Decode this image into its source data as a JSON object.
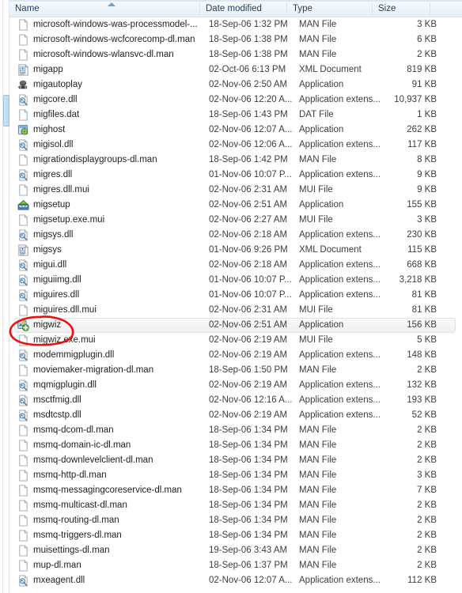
{
  "window": {
    "kind": "file-explorer-details-list"
  },
  "columns": [
    {
      "key": "name",
      "label": "Name",
      "sorted": "ascending"
    },
    {
      "key": "date",
      "label": "Date modified"
    },
    {
      "key": "type",
      "label": "Type"
    },
    {
      "key": "size",
      "label": "Size"
    }
  ],
  "annotation": {
    "shape": "ellipse",
    "color": "#e8120e",
    "target": "migwiz"
  },
  "rows": [
    {
      "icon": "generic-file-icon",
      "name": "microsoft-windows-was-processmodel-...",
      "date": "18-Sep-06 1:32 PM",
      "type": "MAN File",
      "size": "3 KB"
    },
    {
      "icon": "generic-file-icon",
      "name": "microsoft-windows-wcfcorecomp-dl.man",
      "date": "18-Sep-06 1:38 PM",
      "type": "MAN File",
      "size": "6 KB"
    },
    {
      "icon": "generic-file-icon",
      "name": "microsoft-windows-wlansvc-dl.man",
      "date": "18-Sep-06 1:38 PM",
      "type": "MAN File",
      "size": "2 KB"
    },
    {
      "icon": "xml-document-icon",
      "name": "migapp",
      "date": "02-Oct-06 6:13 PM",
      "type": "XML Document",
      "size": "819 KB"
    },
    {
      "icon": "autoplay-app-icon",
      "name": "migautoplay",
      "date": "02-Nov-06 2:50 AM",
      "type": "Application",
      "size": "91 KB"
    },
    {
      "icon": "dll-icon",
      "name": "migcore.dll",
      "date": "02-Nov-06 12:20 A...",
      "type": "Application extens...",
      "size": "10,937 KB"
    },
    {
      "icon": "generic-file-icon",
      "name": "migfiles.dat",
      "date": "18-Sep-06 1:43 PM",
      "type": "DAT File",
      "size": "1 KB"
    },
    {
      "icon": "mighost-app-icon",
      "name": "mighost",
      "date": "02-Nov-06 12:07 A...",
      "type": "Application",
      "size": "262 KB"
    },
    {
      "icon": "dll-icon",
      "name": "migisol.dll",
      "date": "02-Nov-06 12:06 A...",
      "type": "Application extens...",
      "size": "117 KB"
    },
    {
      "icon": "generic-file-icon",
      "name": "migrationdisplaygroups-dl.man",
      "date": "18-Sep-06 1:42 PM",
      "type": "MAN File",
      "size": "8 KB"
    },
    {
      "icon": "dll-icon",
      "name": "migres.dll",
      "date": "01-Nov-06 10:07 P...",
      "type": "Application extens...",
      "size": "9 KB"
    },
    {
      "icon": "generic-file-icon",
      "name": "migres.dll.mui",
      "date": "02-Nov-06 2:31 AM",
      "type": "MUI File",
      "size": "9 KB"
    },
    {
      "icon": "migsetup-app-icon",
      "name": "migsetup",
      "date": "02-Nov-06 2:51 AM",
      "type": "Application",
      "size": "155 KB"
    },
    {
      "icon": "generic-file-icon",
      "name": "migsetup.exe.mui",
      "date": "02-Nov-06 2:27 AM",
      "type": "MUI File",
      "size": "3 KB"
    },
    {
      "icon": "dll-icon",
      "name": "migsys.dll",
      "date": "02-Nov-06 2:18 AM",
      "type": "Application extens...",
      "size": "230 KB"
    },
    {
      "icon": "xml-document-icon",
      "name": "migsys",
      "date": "01-Nov-06 9:26 PM",
      "type": "XML Document",
      "size": "115 KB"
    },
    {
      "icon": "dll-icon",
      "name": "migui.dll",
      "date": "02-Nov-06 2:18 AM",
      "type": "Application extens...",
      "size": "668 KB"
    },
    {
      "icon": "dll-icon",
      "name": "miguiimg.dll",
      "date": "01-Nov-06 10:07 P...",
      "type": "Application extens...",
      "size": "3,218 KB"
    },
    {
      "icon": "dll-icon",
      "name": "miguires.dll",
      "date": "01-Nov-06 10:07 P...",
      "type": "Application extens...",
      "size": "81 KB"
    },
    {
      "icon": "generic-file-icon",
      "name": "miguires.dll.mui",
      "date": "02-Nov-06 2:31 AM",
      "type": "MUI File",
      "size": "81 KB"
    },
    {
      "icon": "migwiz-app-icon",
      "name": "migwiz",
      "date": "02-Nov-06 2:51 AM",
      "type": "Application",
      "size": "156 KB",
      "hovered": true
    },
    {
      "icon": "generic-file-icon",
      "name": "migwiz.exe.mui",
      "date": "02-Nov-06 2:19 AM",
      "type": "MUI File",
      "size": "5 KB"
    },
    {
      "icon": "dll-icon",
      "name": "modemmigplugin.dll",
      "date": "02-Nov-06 2:19 AM",
      "type": "Application extens...",
      "size": "148 KB"
    },
    {
      "icon": "generic-file-icon",
      "name": "moviemaker-migration-dl.man",
      "date": "18-Sep-06 1:50 PM",
      "type": "MAN File",
      "size": "2 KB"
    },
    {
      "icon": "dll-icon",
      "name": "mqmigplugin.dll",
      "date": "02-Nov-06 2:19 AM",
      "type": "Application extens...",
      "size": "132 KB"
    },
    {
      "icon": "dll-icon",
      "name": "msctfmig.dll",
      "date": "02-Nov-06 12:16 A...",
      "type": "Application extens...",
      "size": "193 KB"
    },
    {
      "icon": "dll-icon",
      "name": "msdtcstp.dll",
      "date": "02-Nov-06 2:19 AM",
      "type": "Application extens...",
      "size": "52 KB"
    },
    {
      "icon": "generic-file-icon",
      "name": "msmq-dcom-dl.man",
      "date": "18-Sep-06 1:34 PM",
      "type": "MAN File",
      "size": "2 KB"
    },
    {
      "icon": "generic-file-icon",
      "name": "msmq-domain-ic-dl.man",
      "date": "18-Sep-06 1:34 PM",
      "type": "MAN File",
      "size": "2 KB"
    },
    {
      "icon": "generic-file-icon",
      "name": "msmq-downlevelclient-dl.man",
      "date": "18-Sep-06 1:34 PM",
      "type": "MAN File",
      "size": "2 KB"
    },
    {
      "icon": "generic-file-icon",
      "name": "msmq-http-dl.man",
      "date": "18-Sep-06 1:34 PM",
      "type": "MAN File",
      "size": "3 KB"
    },
    {
      "icon": "generic-file-icon",
      "name": "msmq-messagingcoreservice-dl.man",
      "date": "18-Sep-06 1:34 PM",
      "type": "MAN File",
      "size": "7 KB"
    },
    {
      "icon": "generic-file-icon",
      "name": "msmq-multicast-dl.man",
      "date": "18-Sep-06 1:34 PM",
      "type": "MAN File",
      "size": "2 KB"
    },
    {
      "icon": "generic-file-icon",
      "name": "msmq-routing-dl.man",
      "date": "18-Sep-06 1:34 PM",
      "type": "MAN File",
      "size": "2 KB"
    },
    {
      "icon": "generic-file-icon",
      "name": "msmq-triggers-dl.man",
      "date": "18-Sep-06 1:34 PM",
      "type": "MAN File",
      "size": "2 KB"
    },
    {
      "icon": "generic-file-icon",
      "name": "muisettings-dl.man",
      "date": "19-Sep-06 3:43 AM",
      "type": "MAN File",
      "size": "2 KB"
    },
    {
      "icon": "generic-file-icon",
      "name": "mup-dl.man",
      "date": "18-Sep-06 1:37 PM",
      "type": "MAN File",
      "size": "2 KB"
    },
    {
      "icon": "dll-icon",
      "name": "mxeagent.dll",
      "date": "02-Nov-06 12:07 A...",
      "type": "Application extens...",
      "size": "112 KB"
    }
  ]
}
